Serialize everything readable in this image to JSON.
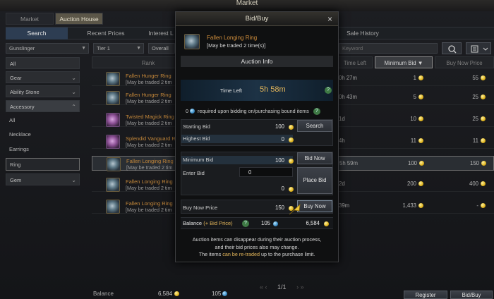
{
  "window": {
    "title": "Market"
  },
  "top_tabs": [
    {
      "label": "Market"
    },
    {
      "label": "Auction House"
    }
  ],
  "sub_tabs": [
    {
      "label": "Search"
    },
    {
      "label": "Recent Prices"
    },
    {
      "label": "Interest L"
    },
    {
      "label": "Sale History"
    }
  ],
  "filters": {
    "class": "Gunslinger",
    "tier": "Tier 1",
    "rarity": "Overall Ra",
    "search_placeholder": "Keyword"
  },
  "sidebar": {
    "categories": [
      {
        "label": "All"
      },
      {
        "label": "Gear"
      },
      {
        "label": "Ability Stone"
      },
      {
        "label": "Accessory"
      }
    ],
    "sub": [
      {
        "label": "All"
      },
      {
        "label": "Necklace"
      },
      {
        "label": "Earrings"
      },
      {
        "label": "Ring"
      }
    ],
    "gem": {
      "label": "Gem"
    }
  },
  "table": {
    "headers": {
      "rank": "Rank",
      "time_left": "Time Left",
      "min_bid": "Minimum Bid",
      "buy_now": "Buy Now Price"
    },
    "rows": [
      {
        "name": "Fallen Hunger Ring",
        "trade": "[May be traded 2 tim",
        "time": "0h 27m",
        "min_bid": "1",
        "buy_now": "55"
      },
      {
        "name": "Fallen Hunger Ring",
        "trade": "[May be traded 2 tim",
        "time": "0h 43m",
        "min_bid": "5",
        "buy_now": "25"
      },
      {
        "name": "Twisted Magick Ring",
        "trade": "[May be traded 2 tim",
        "time": "1d",
        "min_bid": "10",
        "buy_now": "25"
      },
      {
        "name": "Splendid Vanguard R",
        "trade": "[May be traded 2 tim",
        "time": "4h",
        "min_bid": "11",
        "buy_now": "11"
      },
      {
        "name": "Fallen Longing Ring",
        "trade": "[May be traded 2 tim",
        "time": "5h 59m",
        "min_bid": "100",
        "buy_now": "150"
      },
      {
        "name": "Fallen Longing Ring",
        "trade": "[May be traded 2 tim",
        "time": "2d",
        "min_bid": "200",
        "buy_now": "400"
      },
      {
        "name": "Fallen Longing Ring",
        "trade": "[May be traded 2 tim",
        "time": "39m",
        "min_bid": "1,433",
        "buy_now": "-"
      }
    ]
  },
  "footer": {
    "balance_label": "Balance",
    "balance_gold": "6,584",
    "balance_blue": "105",
    "page": "1/1",
    "register": "Register",
    "bid_buy": "Bid/Buy"
  },
  "modal": {
    "title": "Bid/Buy",
    "close": "×",
    "item_name": "Fallen Longing Ring",
    "item_trade": "[May be traded 2 time(s)]",
    "section": "Auction Info",
    "time_left_label": "Time Left",
    "time_left": "5h 58m",
    "bound_count": "0",
    "bound_text": "required upon bidding on/purchasing bound items",
    "starting_bid_label": "Starting Bid",
    "starting_bid": "100",
    "highest_bid_label": "Highest Bid",
    "highest_bid": "0",
    "search_btn": "Search",
    "minimum_bid_label": "Minimum Bid",
    "minimum_bid": "100",
    "enter_bid_label": "Enter Bid",
    "enter_bid": "0",
    "bid_total": "0",
    "bid_now_btn": "Bid Now",
    "place_bid_btn": "Place Bid",
    "buy_now_label": "Buy Now Price",
    "buy_now": "150",
    "buy_now_btn": "Buy Now",
    "balance_label": "Balance",
    "balance_hint": "(+ Bid Price)",
    "balance_blue": "105",
    "balance_gold": "6,584",
    "note1": "Auction items can disappear during their auction process,",
    "note2": "and their bid prices also may change.",
    "note3a": "The items ",
    "note3b": "can be re-traded",
    "note3c": " up to the purchase limit."
  },
  "colors": {
    "accent_gold": "#d9a531",
    "item_name": "#c2863a",
    "time_left": "#e2b55a",
    "highlight": "#3aa0d8"
  }
}
